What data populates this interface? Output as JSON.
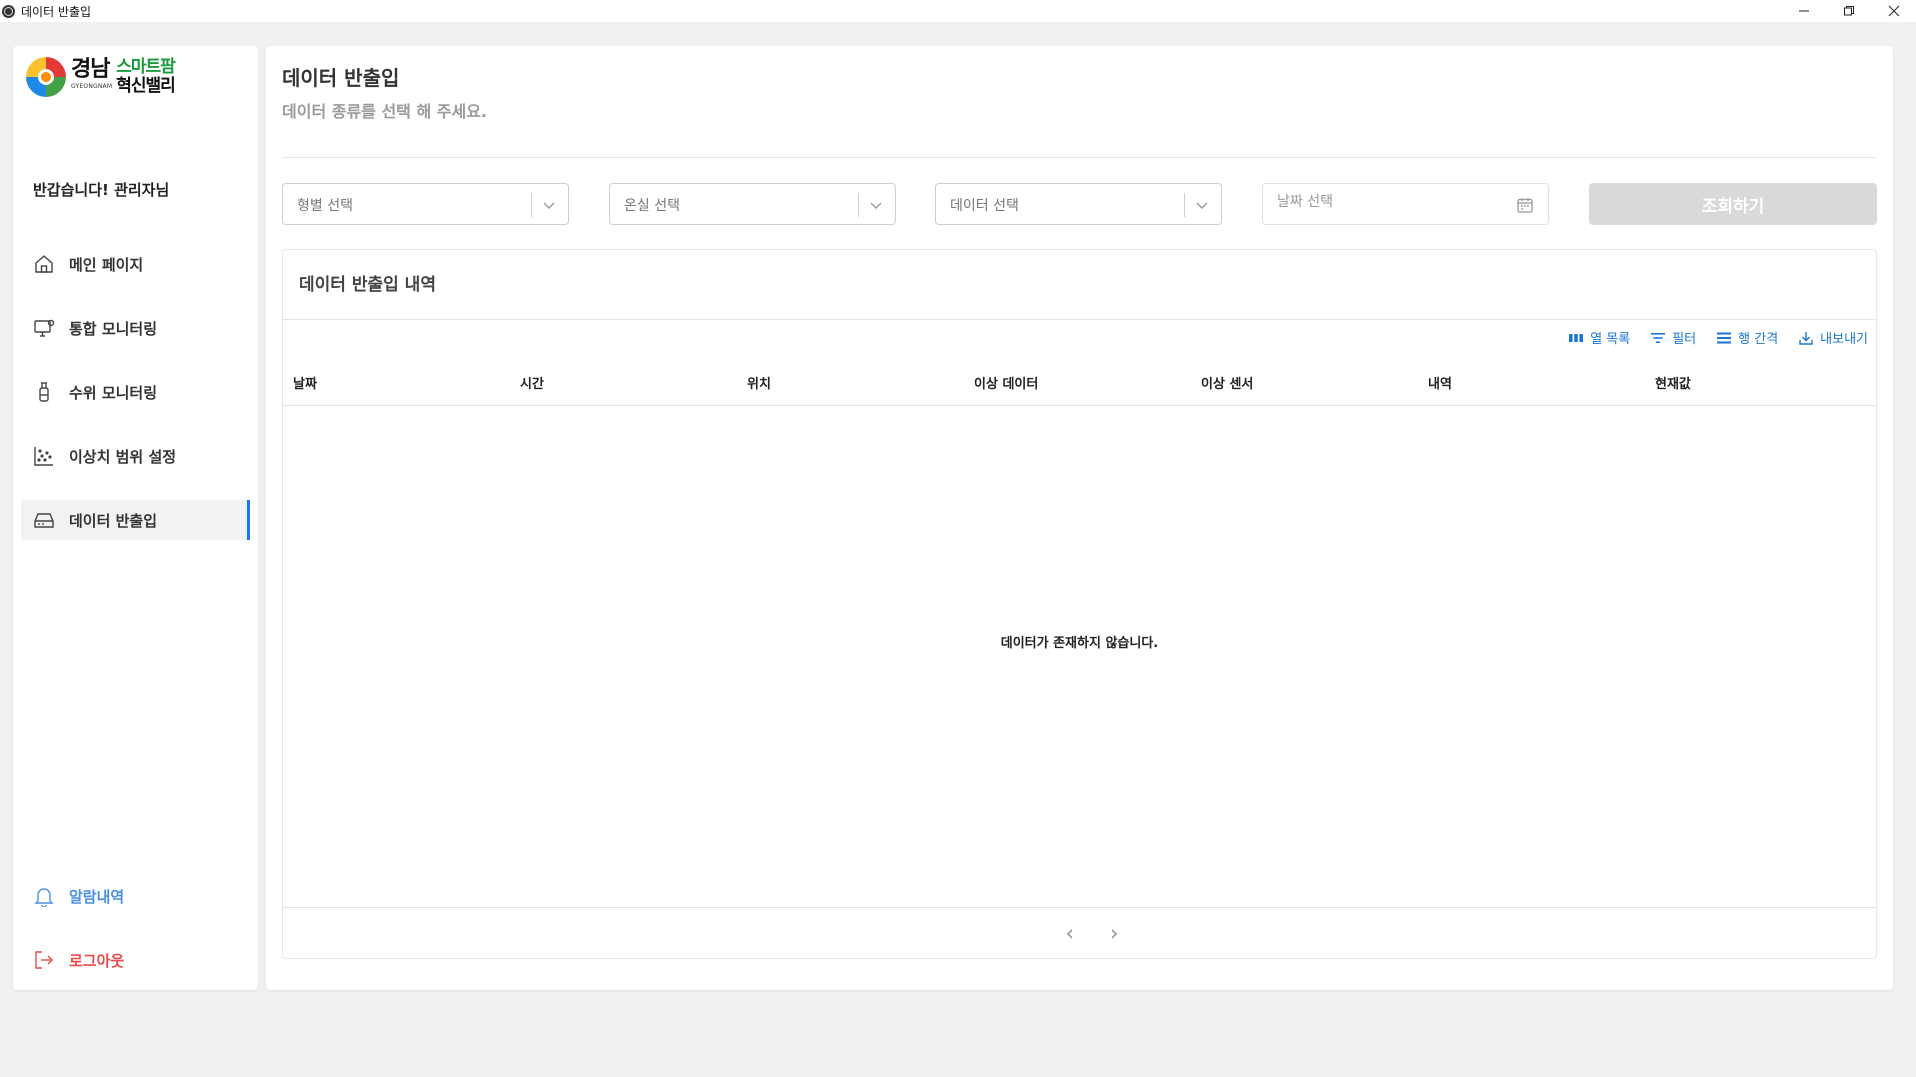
{
  "window": {
    "title": "데이터 반출입"
  },
  "sidebar": {
    "logo": {
      "region": "경남",
      "region_en": "GYEONGNAM",
      "line1": "스마트팜",
      "line2": "혁신밸리"
    },
    "greeting": "반갑습니다!  관리자님",
    "items": [
      {
        "label": "메인 페이지",
        "icon": "home-icon"
      },
      {
        "label": "통합 모니터링",
        "icon": "monitor-icon"
      },
      {
        "label": "수위 모니터링",
        "icon": "water-level-icon"
      },
      {
        "label": "이상치 범위 설정",
        "icon": "scatter-icon"
      },
      {
        "label": "데이터 반출입",
        "icon": "drive-icon",
        "active": true
      }
    ],
    "alarm": {
      "label": "알람내역",
      "color": "#4a90e2"
    },
    "logout": {
      "label": "로그아웃",
      "color": "#e94b4b"
    }
  },
  "main": {
    "title": "데이터 반출입",
    "subtitle": "데이터 종류를 선택 해 주세요.",
    "filters": {
      "select1": "형별 선택",
      "select2": "온실 선택",
      "select3": "데이터 선택",
      "date_placeholder": "날짜 선택",
      "search_label": "조회하기"
    },
    "card": {
      "title": "데이터 반출입 내역",
      "toolbar": {
        "columns": "열 목록",
        "filter": "필터",
        "density": "행 간격",
        "export": "내보내기"
      },
      "columns": [
        "날짜",
        "시간",
        "위치",
        "이상 데이터",
        "이상 센서",
        "내역",
        "현재값"
      ],
      "empty_message": "데이터가 존재하지 않습니다."
    }
  },
  "colors": {
    "accent": "#1677ff",
    "link": "#1976d2",
    "disabled_button": "#d9d9d9"
  }
}
